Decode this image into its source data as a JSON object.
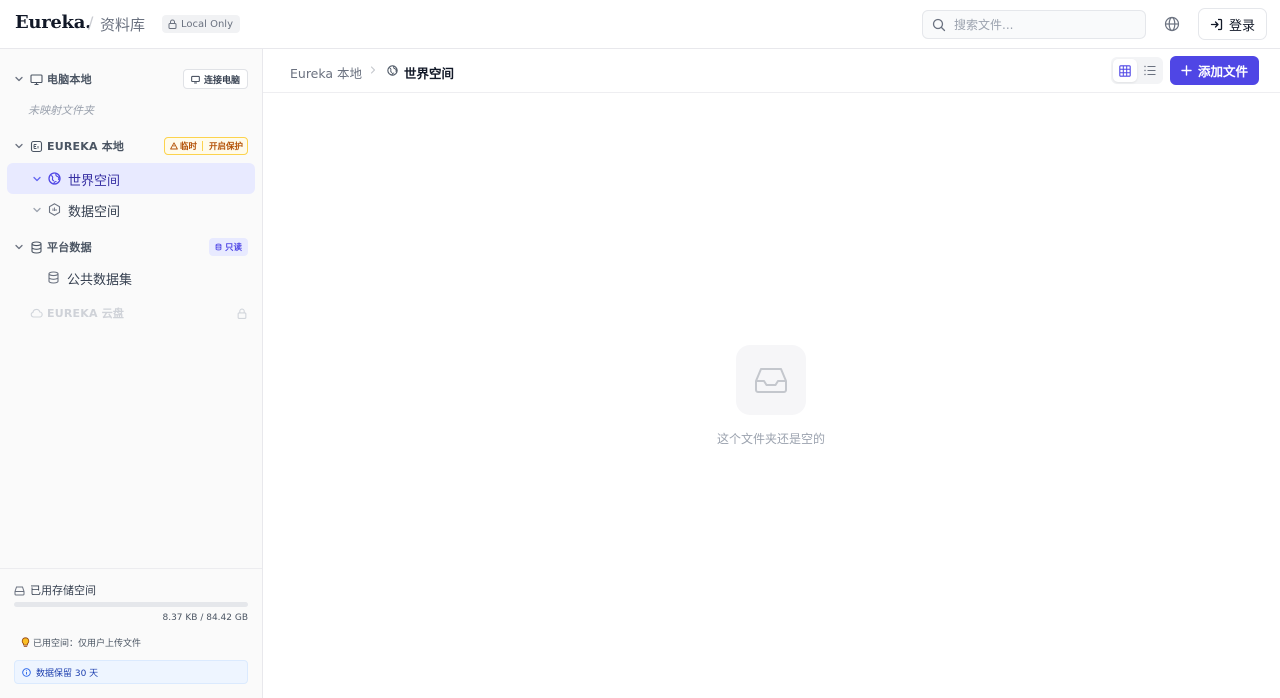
{
  "header": {
    "logo": "Eureka.",
    "separator": "/",
    "section_title": "资料库",
    "local_badge": "Local Only",
    "search_placeholder": "搜索文件...",
    "login_label": "登录"
  },
  "sidebar": {
    "computer": {
      "label": "电脑本地",
      "connect_label": "连接电脑",
      "empty_hint": "未映射文件夹"
    },
    "eureka_local": {
      "label": "EUREKA 本地",
      "temp_label": "临时",
      "protect_label": "开启保护",
      "items": [
        {
          "label": "世界空间",
          "active": true,
          "icon": "globe-icon"
        },
        {
          "label": "数据空间",
          "active": false,
          "icon": "hexagon-icon"
        }
      ]
    },
    "platform": {
      "label": "平台数据",
      "readonly_label": "只读",
      "items": [
        {
          "label": "公共数据集",
          "icon": "database-icon"
        }
      ]
    },
    "cloud": {
      "label": "EUREKA 云盘"
    },
    "storage": {
      "title": "已用存储空间",
      "amount": "8.37 KB / 84.42 GB",
      "used_fraction": 0.0,
      "hint": "已用空间：仅用户上传文件",
      "retention": "数据保留 30 天"
    }
  },
  "main": {
    "breadcrumb_root": "Eureka 本地",
    "breadcrumb_current": "世界空间",
    "add_label": "添加文件",
    "empty_text": "这个文件夹还是空的"
  },
  "colors": {
    "accent": "#4f46e5",
    "active_bg": "#e8eaff",
    "warning": "#b45309"
  }
}
